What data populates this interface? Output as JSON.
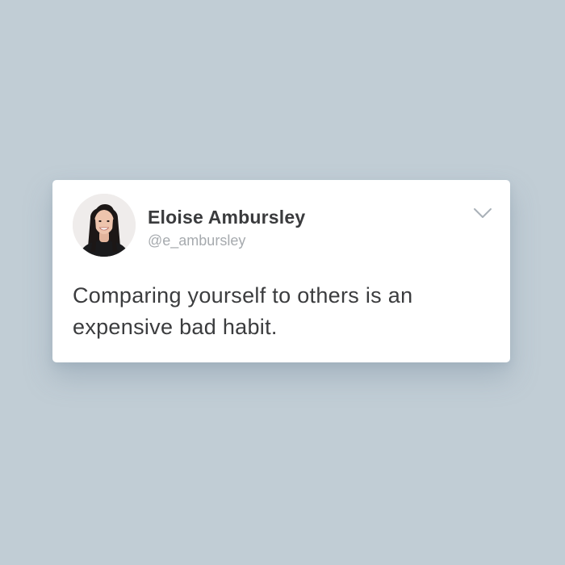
{
  "background_color": "#c1cdd5",
  "tweet_card": {
    "author": {
      "name": "Eloise Ambursley",
      "handle": "@e_ambursley",
      "avatar": "profile-photo"
    },
    "text": "Comparing yourself to others is an expensive bad habit.",
    "menu_icon": "chevron-down-icon"
  }
}
